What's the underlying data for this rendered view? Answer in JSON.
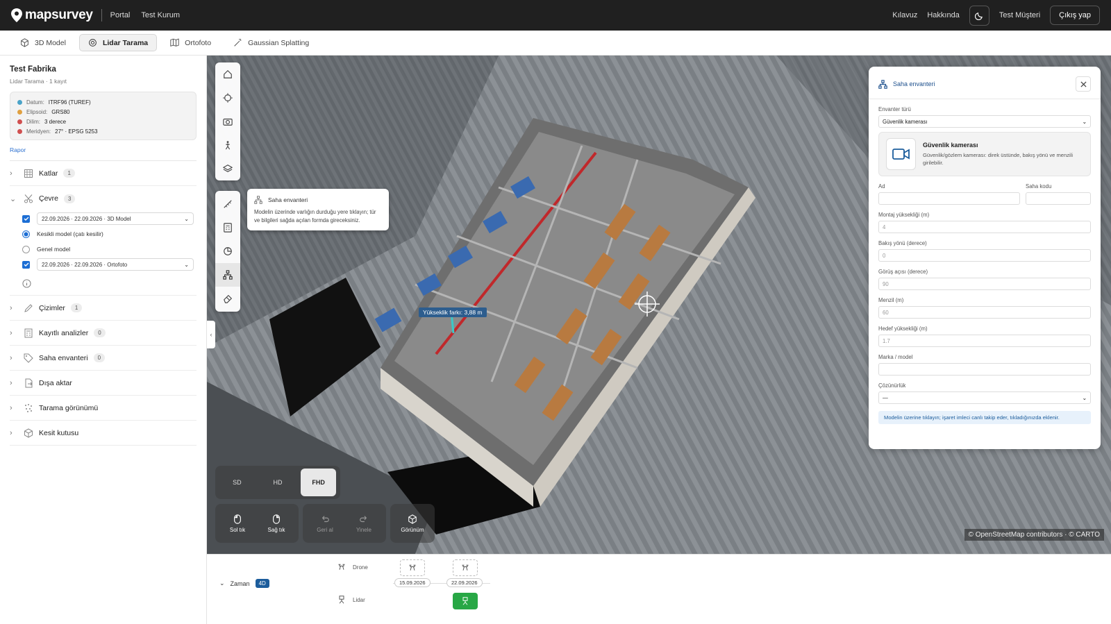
{
  "app": {
    "brand": "mapsurvey",
    "brand_tagline": "",
    "portal": "Portal",
    "org": "Test Kurum"
  },
  "topbar": {
    "guide": "Kılavuz",
    "about": "Hakkında",
    "user": "Test Müşteri",
    "logout": "Çıkış yap"
  },
  "tabs": [
    {
      "label": "3D Model",
      "icon": "cube-icon"
    },
    {
      "label": "Lidar Tarama",
      "icon": "lidar-icon",
      "active": true
    },
    {
      "label": "Ortofoto",
      "icon": "map-icon"
    },
    {
      "label": "Gaussian Splatting",
      "icon": "wand-icon"
    }
  ],
  "project": {
    "title": "Test Fabrika",
    "subtitle": "Lidar Tarama · 1 kayıt",
    "info": [
      {
        "label": "Datum:",
        "value": "ITRF96 (TUREF)",
        "color": "#4aa3c8"
      },
      {
        "label": "Elipsoid:",
        "value": "GRS80",
        "color": "#e0a040"
      },
      {
        "label": "Dilim:",
        "value": "3 derece",
        "color": "#d05050"
      },
      {
        "label": "Meridyen:",
        "value": "27° · EPSG 5253",
        "color": "#d05050"
      }
    ],
    "report": "Rapor"
  },
  "sections": {
    "katlar": {
      "label": "Katlar",
      "count": "1"
    },
    "cevre": {
      "label": "Çevre",
      "count": "3"
    },
    "cevre_items": {
      "model_select": "22.09.2026 · 22.09.2026 · 3D Model",
      "radio1": "Kesikli model (çatı kesilir)",
      "radio2": "Genel model",
      "ortho_select": "22.09.2026 · 22.09.2026 · Ortofoto"
    },
    "cizimler": {
      "label": "Çizimler",
      "count": "1"
    },
    "analizler": {
      "label": "Kayıtlı analizler",
      "count": "0"
    },
    "envanter": {
      "label": "Saha envanteri",
      "count": "0"
    },
    "disa": {
      "label": "Dışa aktar"
    },
    "tarama": {
      "label": "Tarama görünümü"
    },
    "kesit": {
      "label": "Kesit kutusu"
    }
  },
  "viewer": {
    "tooltip": {
      "title": "Saha envanteri",
      "desc": "Modelin üzerinde varlığın durduğu yere tıklayın; tür ve bilgileri sağda açılan formda gireceksiniz."
    },
    "measure": "Yükseklik farkı: 3,88 m",
    "quality": [
      "SD",
      "HD",
      "FHD"
    ],
    "quality_active": "FHD",
    "controls": {
      "left": "Sol tık",
      "right": "Sağ tık",
      "undo": "Geri al",
      "redo": "Yinele",
      "view": "Görünüm"
    },
    "attribution": "© OpenStreetMap contributors · © CARTO"
  },
  "panel": {
    "title": "Saha envanteri",
    "type_label": "Envanter türü",
    "type_value": "Güvenlik kamerası",
    "card_title": "Güvenlik kamerası",
    "card_desc": "Güvenlik/gözlem kamerası: direk üstünde, bakış yönü ve menzili girilebilir.",
    "name_label": "Ad",
    "code_label": "Saha kodu",
    "mount_label": "Montaj yüksekliği (m)",
    "mount_value": "4",
    "dir_label": "Bakış yönü (derece)",
    "dir_value": "0",
    "fov_label": "Görüş açısı (derece)",
    "fov_value": "90",
    "range_label": "Menzil (m)",
    "range_value": "60",
    "target_label": "Hedef yüksekliği (m)",
    "target_value": "1.7",
    "brand_label": "Marka / model",
    "res_label": "Çözünürlük",
    "res_value": "—",
    "note": "Modelin üzerine tıklayın; işaret imleci canlı takip eder, tıkladığınızda eklenir."
  },
  "timeline": {
    "label": "Zaman",
    "badge": "4D",
    "drone": "Drone",
    "lidar": "Lidar",
    "dates": [
      "15.09.2026",
      "22.09.2026"
    ]
  }
}
